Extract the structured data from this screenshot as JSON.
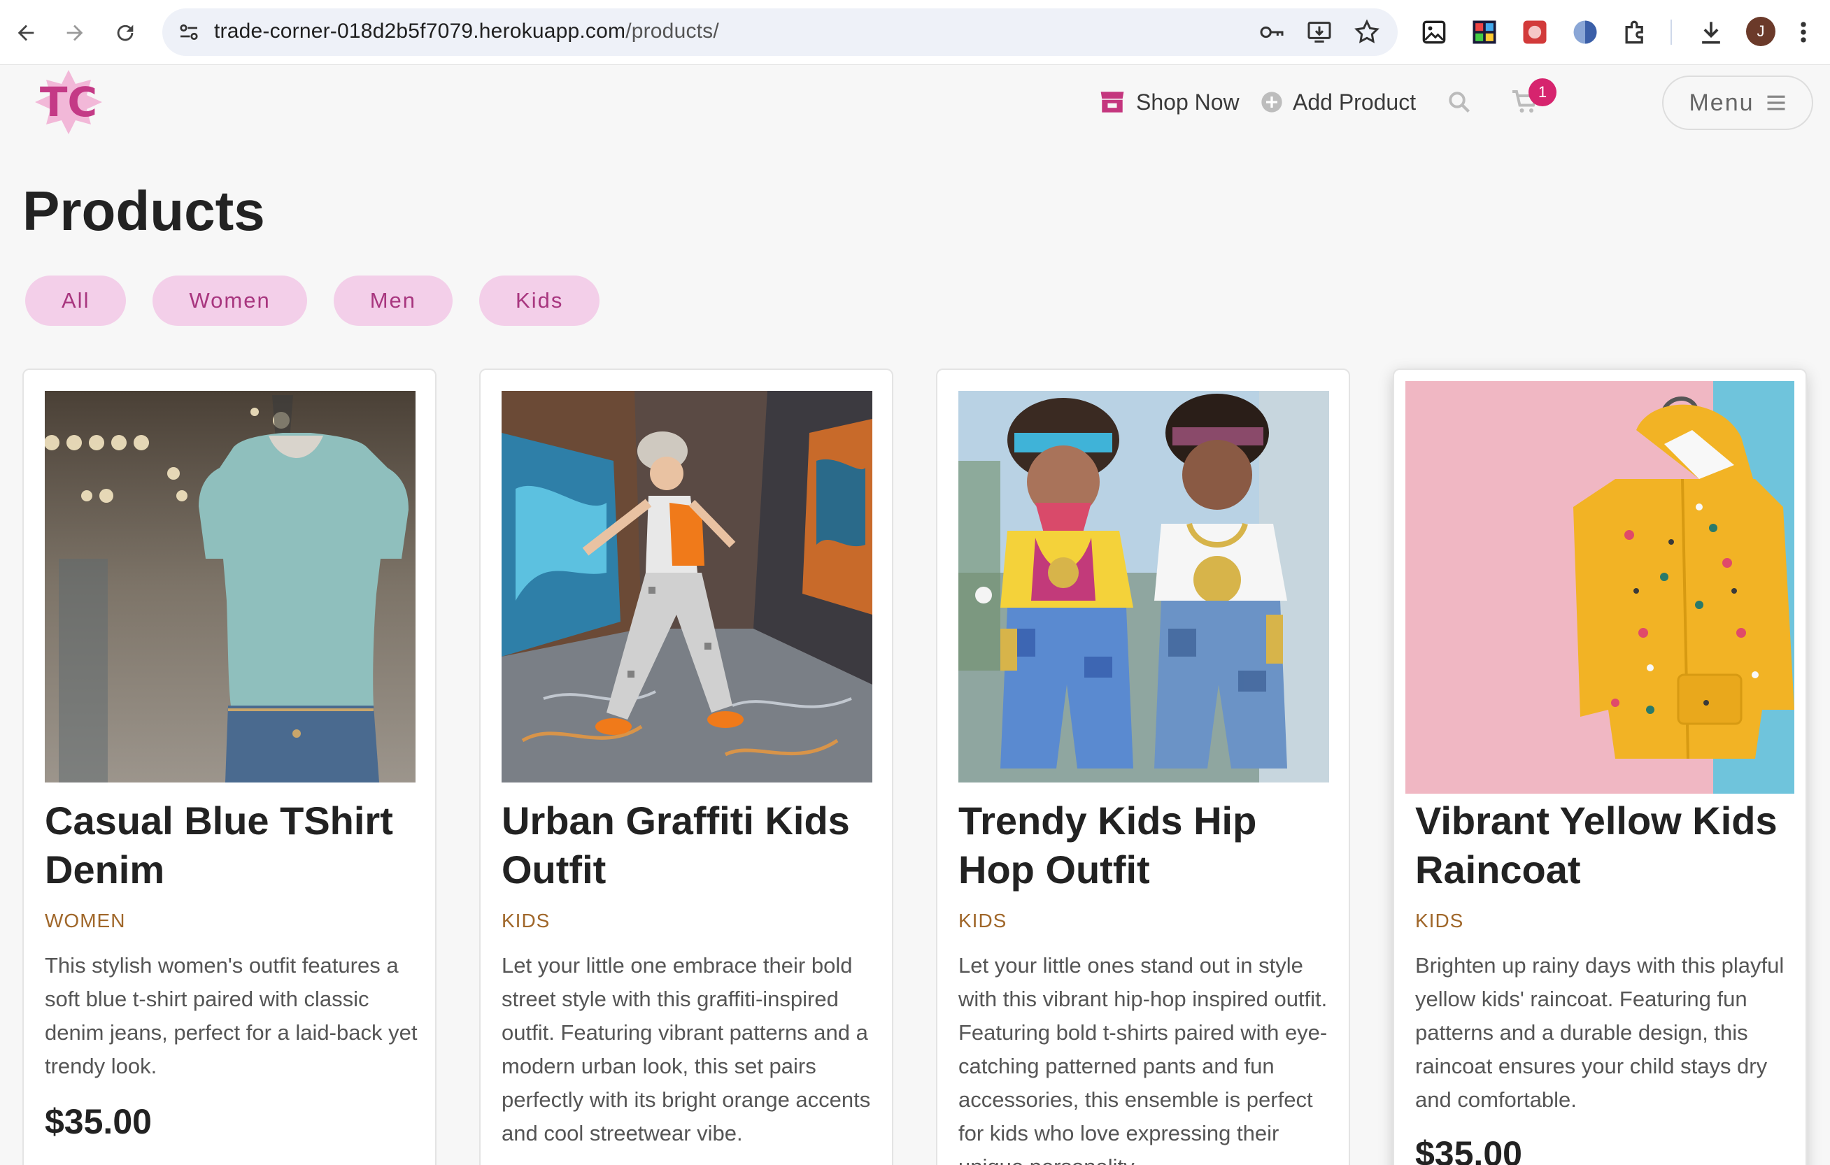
{
  "browser": {
    "url_host": "trade-corner-018d2b5f7079.herokuapp.com",
    "url_path": "/products/",
    "profile_initial": "J",
    "icons": [
      "back-icon",
      "forward-icon",
      "reload-icon",
      "site-settings-icon",
      "password-key-icon",
      "install-app-icon",
      "bookmark-star-icon",
      "image-extension-icon",
      "extension-icon",
      "extension-icon",
      "extension-icon",
      "extensions-puzzle-icon",
      "download-icon",
      "more-vert-icon"
    ]
  },
  "header": {
    "logo_text": "TC",
    "nav": [
      {
        "label": "Shop Now",
        "icon": "store-icon"
      },
      {
        "label": "Add Product",
        "icon": "plus-circle-icon"
      }
    ],
    "cart_count": "1",
    "menu_label": "Menu"
  },
  "page": {
    "title": "Products",
    "filters": [
      "All",
      "Women",
      "Men",
      "Kids"
    ]
  },
  "products": [
    {
      "title": "Casual Blue TShirt Denim",
      "category": "WOMEN",
      "description": "This stylish women's outfit features a soft blue t-shirt paired with classic denim jeans, perfect for a laid-back yet trendy look.",
      "price": "$35.00"
    },
    {
      "title": "Urban Graffiti Kids Outfit",
      "category": "KIDS",
      "description": "Let your little one embrace their bold street style with this graffiti-inspired outfit. Featuring vibrant patterns and a modern urban look, this set pairs perfectly with its bright orange accents and cool streetwear vibe.",
      "price": ""
    },
    {
      "title": "Trendy Kids Hip Hop Outfit",
      "category": "KIDS",
      "description": "Let your little ones stand out in style with this vibrant hip-hop inspired outfit. Featuring bold t-shirts paired with eye-catching patterned pants and fun accessories, this ensemble is perfect for kids who love expressing their unique personality.",
      "price": ""
    },
    {
      "title": "Vibrant Yellow Kids Raincoat",
      "category": "KIDS",
      "description": "Brighten up rainy days with this playful yellow kids' raincoat. Featuring fun patterns and a durable design, this raincoat ensures your child stays dry and comfortable.",
      "price": "$35.00"
    }
  ],
  "colors": {
    "accent": "#d6246e",
    "chip_bg": "#f3cfe9",
    "chip_text": "#a8367f",
    "category_text": "#a0672a"
  }
}
